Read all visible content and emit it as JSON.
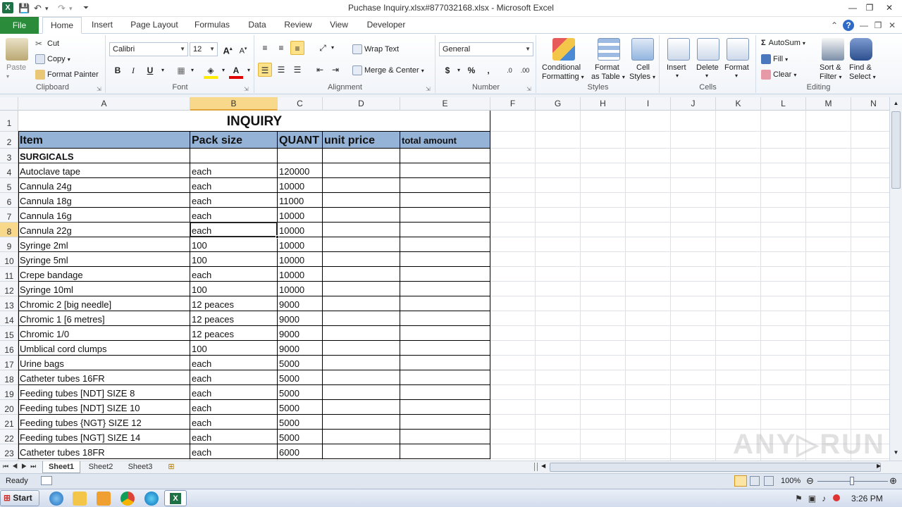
{
  "window": {
    "title": "Puchase Inquiry.xlsx#877032168.xlsx  -  Microsoft Excel",
    "app_icon_letter": "X"
  },
  "tabs": [
    {
      "label": "File"
    },
    {
      "label": "Home"
    },
    {
      "label": "Insert"
    },
    {
      "label": "Page Layout"
    },
    {
      "label": "Formulas"
    },
    {
      "label": "Data"
    },
    {
      "label": "Review"
    },
    {
      "label": "View"
    },
    {
      "label": "Developer"
    }
  ],
  "ribbon": {
    "clipboard": {
      "label": "Clipboard",
      "paste": "Paste",
      "cut": "Cut",
      "copy": "Copy",
      "format_painter": "Format Painter"
    },
    "font": {
      "label": "Font",
      "font_name": "Calibri",
      "font_size": "12",
      "bold": "B",
      "italic": "I",
      "underline": "U"
    },
    "alignment": {
      "label": "Alignment",
      "wrap_text": "Wrap Text",
      "merge_center": "Merge & Center"
    },
    "number": {
      "label": "Number",
      "format": "General",
      "currency": "$",
      "percent": "%",
      "comma": ","
    },
    "styles": {
      "label": "Styles",
      "conditional_1": "Conditional",
      "conditional_2": "Formatting",
      "format_table_1": "Format",
      "format_table_2": "as Table",
      "cell_styles_1": "Cell",
      "cell_styles_2": "Styles"
    },
    "cells": {
      "label": "Cells",
      "insert": "Insert",
      "delete": "Delete",
      "format": "Format"
    },
    "editing": {
      "label": "Editing",
      "autosum": "AutoSum",
      "fill": "Fill",
      "clear": "Clear",
      "sort_1": "Sort &",
      "sort_2": "Filter",
      "find_1": "Find &",
      "find_2": "Select"
    }
  },
  "columns": [
    "A",
    "B",
    "C",
    "D",
    "E",
    "F",
    "G",
    "H",
    "I",
    "J",
    "K",
    "L",
    "M",
    "N"
  ],
  "rows": [
    "1",
    "2",
    "3",
    "4",
    "5",
    "6",
    "7",
    "8",
    "9",
    "10",
    "11",
    "12",
    "13",
    "14",
    "15",
    "16",
    "17",
    "18",
    "19",
    "20",
    "21",
    "22",
    "23"
  ],
  "sheet": {
    "title": "INQUIRY",
    "headers": [
      "Item",
      "Pack size",
      "QUANT",
      "unit price",
      "total amount"
    ],
    "section": "SURGICALS",
    "items": [
      [
        "Autoclave tape",
        "each",
        "120000"
      ],
      [
        "Cannula 24g",
        "each",
        "10000"
      ],
      [
        "Cannula 18g",
        "each",
        "11000"
      ],
      [
        "Cannula 16g",
        "each",
        "10000"
      ],
      [
        "Cannula 22g",
        "each",
        "10000"
      ],
      [
        "Syringe 2ml",
        "100",
        "10000"
      ],
      [
        "Syringe 5ml",
        "100",
        "10000"
      ],
      [
        "Crepe bandage",
        "each",
        "10000"
      ],
      [
        "Syringe 10ml",
        "100",
        "10000"
      ],
      [
        "Chromic 2 [big needle]",
        "12 peaces",
        "9000"
      ],
      [
        "Chromic 1 [6 metres]",
        "12 peaces",
        "9000"
      ],
      [
        "Chromic 1/0",
        "12 peaces",
        "9000"
      ],
      [
        "Umblical cord clumps",
        "100",
        "9000"
      ],
      [
        "Urine bags",
        "each",
        "5000"
      ],
      [
        "Catheter tubes 16FR",
        "each",
        "5000"
      ],
      [
        "Feeding tubes [NDT] SIZE    8",
        "each",
        "5000"
      ],
      [
        "Feeding tubes [NDT] SIZE    10",
        "each",
        "5000"
      ],
      [
        "Feeding tubes {NGT}  SIZE 12",
        "each",
        "5000"
      ],
      [
        "Feeding tubes [NGT] SIZE 14",
        "each",
        "5000"
      ],
      [
        "Catheter tubes 18FR",
        "each",
        "6000"
      ]
    ]
  },
  "sheet_tabs": [
    "Sheet1",
    "Sheet2",
    "Sheet3"
  ],
  "status": {
    "ready": "Ready",
    "zoom": "100%"
  },
  "taskbar": {
    "start": "Start",
    "time": "3:26 PM"
  },
  "watermark": "ANY RUN"
}
